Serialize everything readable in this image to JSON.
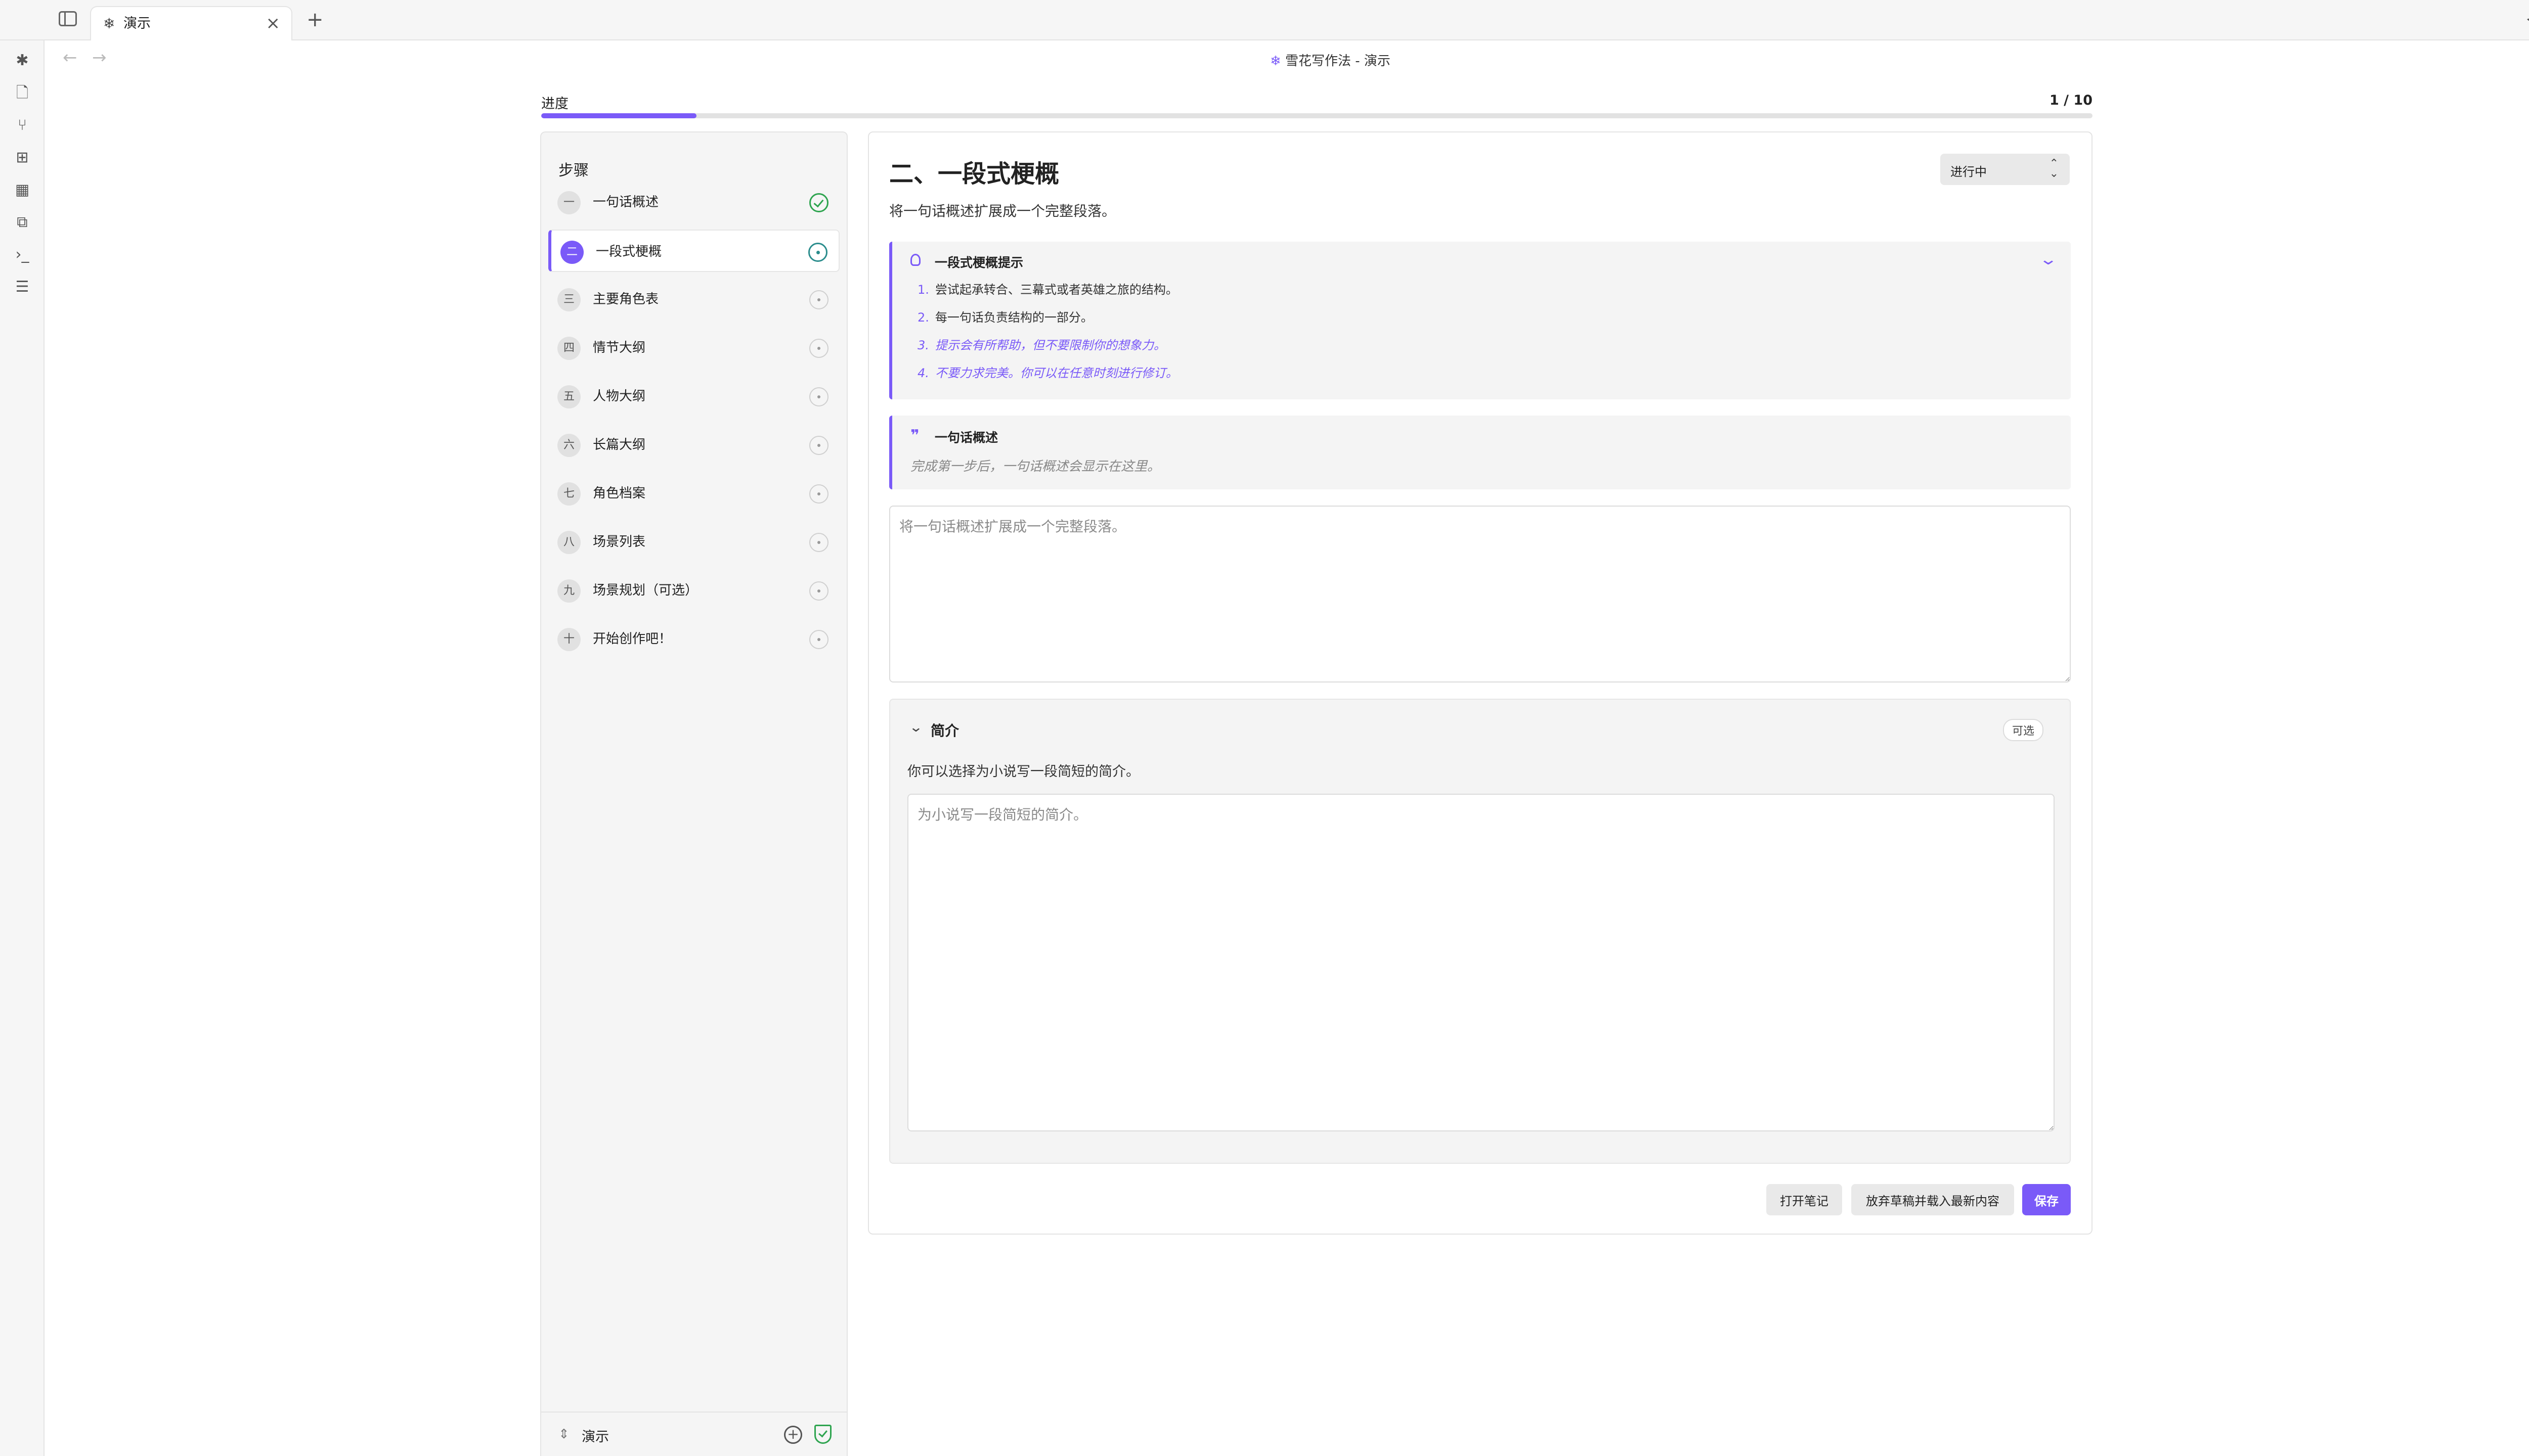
{
  "tabbar": {
    "tab_label": "演示",
    "tab_icon": "snowflake-icon",
    "close_glyph": "×",
    "add_glyph": "+"
  },
  "header": {
    "view_title": "雪花写作法 - 演示",
    "more_glyph": "···"
  },
  "progress": {
    "label": "进度",
    "count": "1 / 10",
    "fraction": 0.1
  },
  "steps_panel": {
    "title": "步骤",
    "items": [
      {
        "num": "一",
        "label": "一句话概述",
        "status": "done"
      },
      {
        "num": "二",
        "label": "一段式梗概",
        "status": "current"
      },
      {
        "num": "三",
        "label": "主要角色表",
        "status": "pending"
      },
      {
        "num": "四",
        "label": "情节大纲",
        "status": "pending"
      },
      {
        "num": "五",
        "label": "人物大纲",
        "status": "pending"
      },
      {
        "num": "六",
        "label": "长篇大纲",
        "status": "pending"
      },
      {
        "num": "七",
        "label": "角色档案",
        "status": "pending"
      },
      {
        "num": "八",
        "label": "场景列表",
        "status": "pending"
      },
      {
        "num": "九",
        "label": "场景规划（可选）",
        "status": "pending"
      },
      {
        "num": "十",
        "label": "开始创作吧！",
        "status": "pending"
      }
    ],
    "project_name": "演示"
  },
  "main": {
    "step_title": "二、一段式梗概",
    "status_value": "进行中",
    "step_desc": "将一句话概述扩展成一个完整段落。",
    "tips": {
      "title": "一段式梗概提示",
      "items": [
        {
          "n": "1.",
          "text": "尝试起承转合、三幕式或者英雄之旅的结构。"
        },
        {
          "n": "2.",
          "text": "每一句话负责结构的一部分。"
        },
        {
          "n": "3.",
          "text": "提示会有所帮助，但不要限制你的想象力。"
        },
        {
          "n": "4.",
          "text": "不要力求完美。你可以在任意时刻进行修订。"
        }
      ]
    },
    "reference": {
      "title": "一句话概述",
      "body": "完成第一步后，一句话概述会显示在这里。"
    },
    "paragraph_placeholder": "将一句话概述扩展成一个完整段落。",
    "summary": {
      "title": "简介",
      "badge": "可选",
      "desc": "你可以选择为小说写一段简短的简介。",
      "placeholder": "为小说写一段简短的简介。"
    },
    "buttons": {
      "open_note": "打开笔记",
      "discard": "放弃草稿并载入最新内容",
      "save": "保存"
    }
  },
  "colors": {
    "accent": "#7a5af8",
    "done": "#2ea44f",
    "current": "#2a8c8c"
  }
}
